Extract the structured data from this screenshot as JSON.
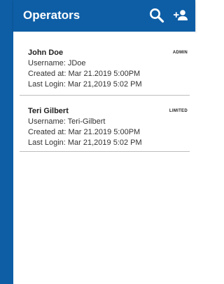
{
  "app_bar": {
    "title": "Operators",
    "search_icon": "search-icon",
    "add_user_icon": "add-user-icon",
    "color": "#0e5ea6"
  },
  "operators": [
    {
      "name": "John Doe",
      "role": "ADMIN",
      "username": "Username: JDoe",
      "created_at": "Created at: Mar 21.2019 5:00PM",
      "last_login": "Last Login: Mar 21,2019 5:02 PM"
    },
    {
      "name": "Teri Gilbert",
      "role": "LIMITED",
      "username": "Username: Teri-Gilbert",
      "created_at": "Created at: Mar 21.2019 5:00PM",
      "last_login": "Last Login: Mar 21,2019 5:02 PM"
    }
  ]
}
